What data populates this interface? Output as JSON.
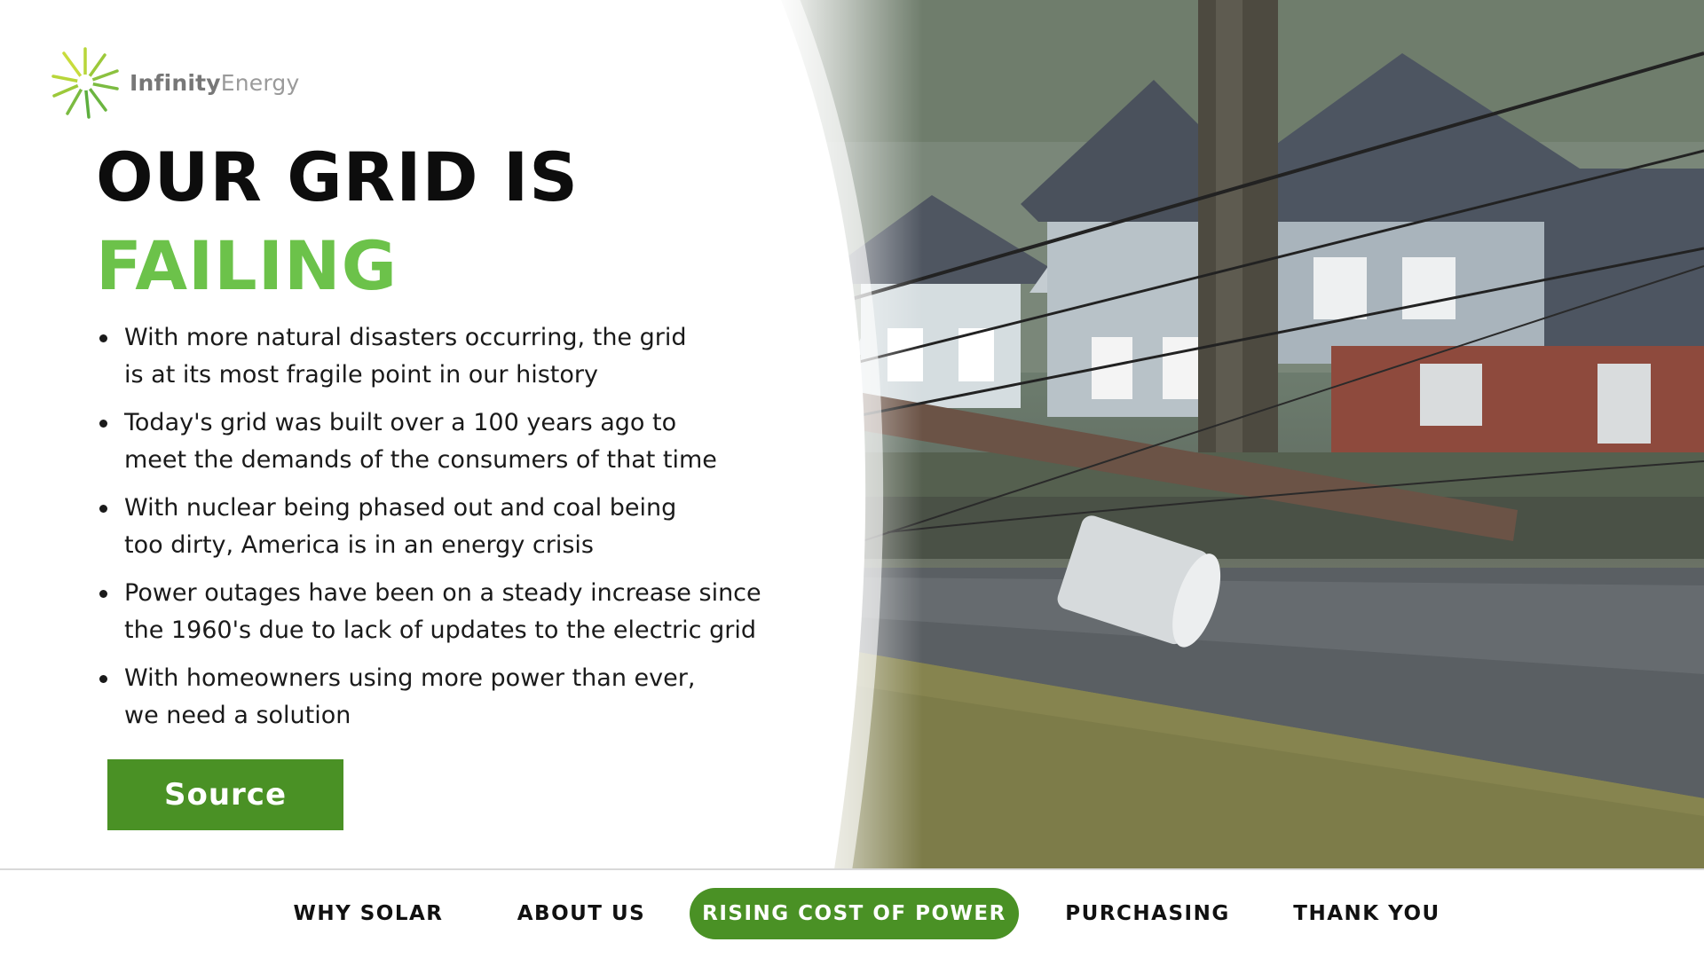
{
  "logo": {
    "word1": "Infinity",
    "word2": "Energy",
    "icon": "sunburst-logo-icon"
  },
  "headline": {
    "line1": "OUR GRID IS",
    "line2": "FAILING",
    "accent_color": "#6cc24a"
  },
  "bullets": [
    {
      "lines": [
        "With more natural disasters occurring, the grid",
        "is at its most fragile point in our history"
      ]
    },
    {
      "lines": [
        "Today's grid was built over a 100 years ago to",
        "meet the demands of the consumers of that time"
      ]
    },
    {
      "lines": [
        "With nuclear being phased out and coal being",
        "too dirty, America is in an energy crisis"
      ]
    },
    {
      "lines": [
        "Power outages have been on a steady increase since",
        "the 1960's due to lack of updates to the electric grid"
      ]
    },
    {
      "lines": [
        "With homeowners using more power than ever,",
        "we need a solution"
      ]
    }
  ],
  "source_button": {
    "label": "Source",
    "color": "#4a9125"
  },
  "photo": {
    "subject": "downed-utility-pole-photo"
  },
  "nav": {
    "items": [
      {
        "label": "WHY SOLAR",
        "active": false
      },
      {
        "label": "ABOUT US",
        "active": false
      },
      {
        "label": "RISING COST OF POWER",
        "active": true
      },
      {
        "label": "PURCHASING",
        "active": false
      },
      {
        "label": "THANK YOU",
        "active": false
      }
    ],
    "active_color": "#4a9125"
  }
}
